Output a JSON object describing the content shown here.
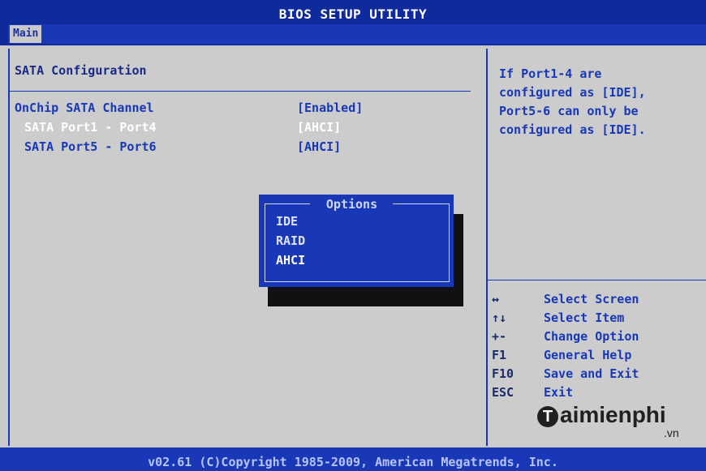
{
  "window": {
    "title": "BIOS SETUP UTILITY"
  },
  "tabs": [
    {
      "label": "Main"
    }
  ],
  "section": {
    "title": "SATA Configuration"
  },
  "settings": [
    {
      "label": "OnChip SATA Channel",
      "value": "[Enabled]"
    },
    {
      "label": "SATA Port1 - Port4",
      "value": "[AHCI]"
    },
    {
      "label": "SATA Port5 - Port6",
      "value": "[AHCI]"
    }
  ],
  "help": {
    "lines": [
      "If Port1-4 are",
      "configured as [IDE],",
      "Port5-6 can only be",
      "configured as [IDE]."
    ]
  },
  "popup": {
    "title": "Options",
    "options": [
      "IDE",
      "RAID",
      "AHCI"
    ],
    "selected": "AHCI"
  },
  "keys": [
    {
      "key": "↔",
      "desc": "Select Screen"
    },
    {
      "key": "↑↓",
      "desc": "Select Item"
    },
    {
      "key": "+-",
      "desc": "Change Option"
    },
    {
      "key": "F1",
      "desc": "General Help"
    },
    {
      "key": "F10",
      "desc": "Save and Exit"
    },
    {
      "key": "ESC",
      "desc": "Exit"
    }
  ],
  "watermark": {
    "brand": "aimienphi",
    "mark": "T",
    "tld": ".vn"
  },
  "footer": {
    "text": "v02.61 (C)Copyright 1985-2009, American Megatrends, Inc."
  },
  "colors": {
    "frame": "#1838b8",
    "panel": "#cccccc",
    "text": "#1838b8"
  }
}
